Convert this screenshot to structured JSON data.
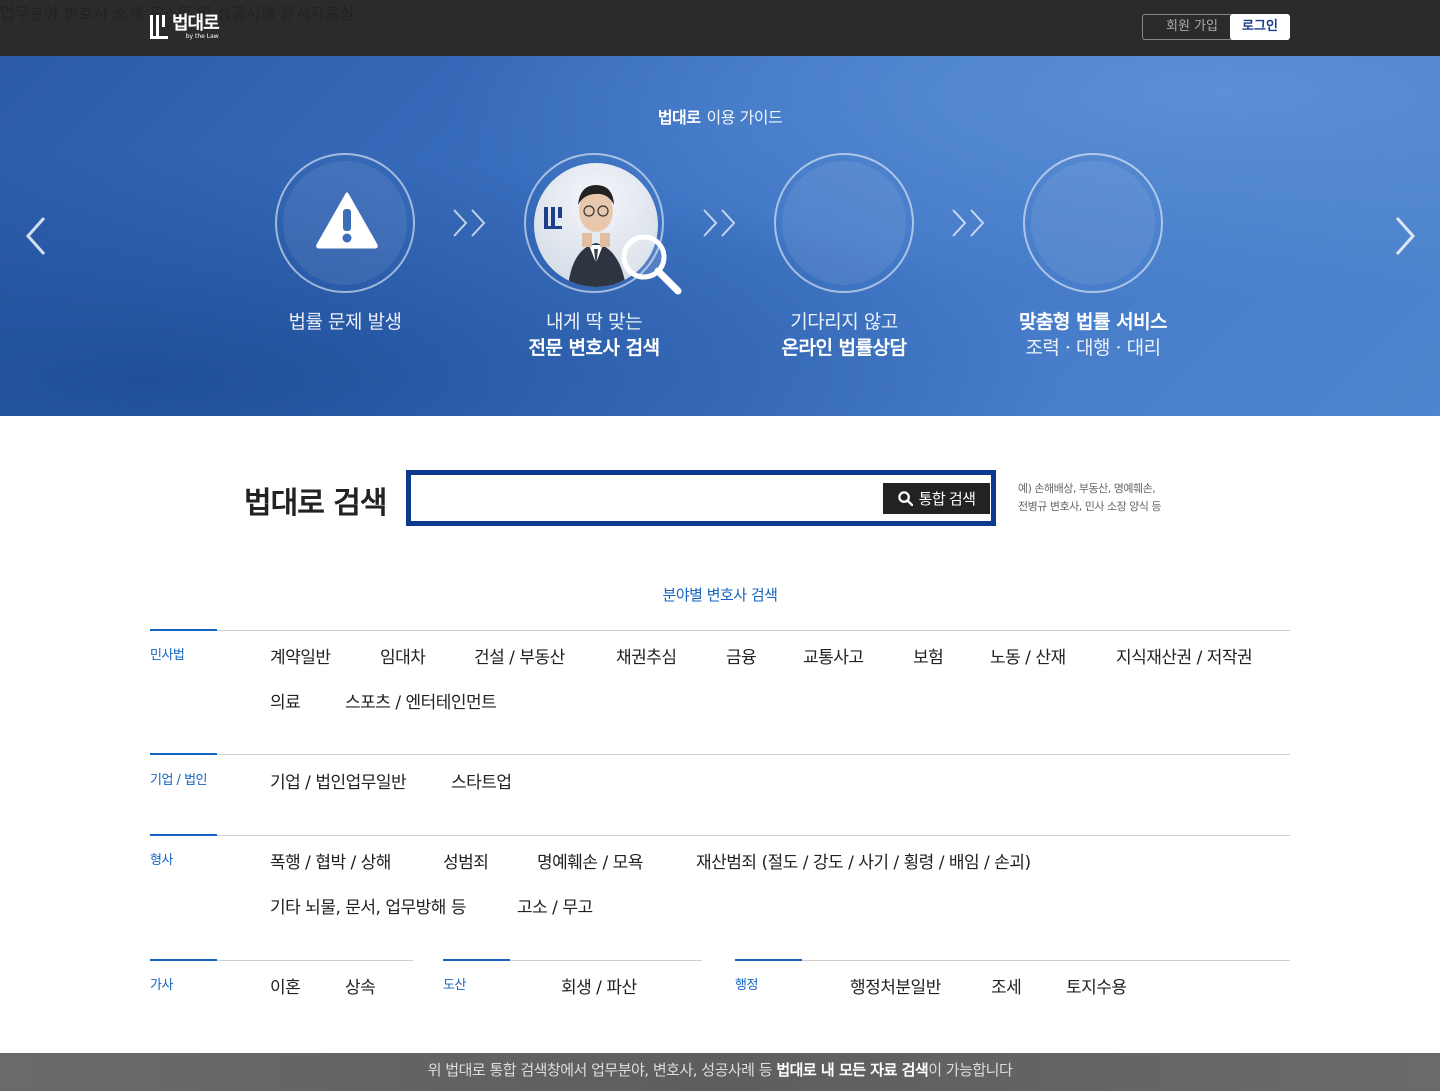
{
  "header": {
    "logo_text": "법대로",
    "logo_sub": "by the Law",
    "nav": [
      "업무분야",
      "변호사 소개",
      "포스트 및 성공사례",
      "문서자료실"
    ],
    "join_label": "회원 가입",
    "login_label": "로그인"
  },
  "hero": {
    "title_brand": "법대로",
    "title_text": "이용 가이드",
    "steps": [
      {
        "line1": "법률 문제 발생",
        "line2": ""
      },
      {
        "line1": "내게 딱 맞는",
        "line2": "전문 변호사 검색"
      },
      {
        "line1": "기다리지 않고",
        "line2": "온라인 법률상담"
      },
      {
        "line1": "조력 · 대행 · 대리",
        "line2": "맞춤형 법률 서비스"
      }
    ]
  },
  "search": {
    "title": "법대로 검색",
    "input_value": "",
    "button_label": "통합 검색",
    "hint_line1": "예) 손해배상, 부동산, 명예훼손,",
    "hint_line2": "전병규 변호사, 민사 소장 양식 등"
  },
  "fields": {
    "title": "분야별 변호사 검색",
    "categories": [
      {
        "name": "민사법",
        "tags": [
          "계약일반",
          "임대차",
          "건설 / 부동산",
          "채권추심",
          "금융",
          "교통사고",
          "보험",
          "노동 / 산재",
          "지식재산권 / 저작권",
          "의료",
          "스포츠 / 엔터테인먼트"
        ]
      },
      {
        "name": "기업 / 법인",
        "tags": [
          "기업 / 법인업무일반",
          "스타트업"
        ]
      },
      {
        "name": "형사",
        "tags": [
          "폭행 / 협박 / 상해",
          "성범죄",
          "명예훼손 / 모욕",
          "재산범죄 (절도 / 강도 / 사기 / 횡령 / 배임 / 손괴)",
          "기타 뇌물, 문서, 업무방해 등",
          "고소 / 무고"
        ]
      },
      {
        "name": "가사",
        "tags": [
          "이혼",
          "상속"
        ]
      },
      {
        "name": "도산",
        "tags": [
          "회생 / 파산"
        ]
      },
      {
        "name": "행정",
        "tags": [
          "행정처분일반",
          "조세",
          "토지수용"
        ]
      }
    ]
  },
  "footer": {
    "text_before": "위 법대로 통합 검색창에서 업무분야, 변호사, 성공사례 등 ",
    "text_bold": "법대로 내 모든 자료 검색",
    "text_after": "이 가능합니다"
  },
  "colors": {
    "accent": "#1565c0",
    "search_border": "#0b3a8f",
    "header_bg": "#2b2b2b"
  }
}
